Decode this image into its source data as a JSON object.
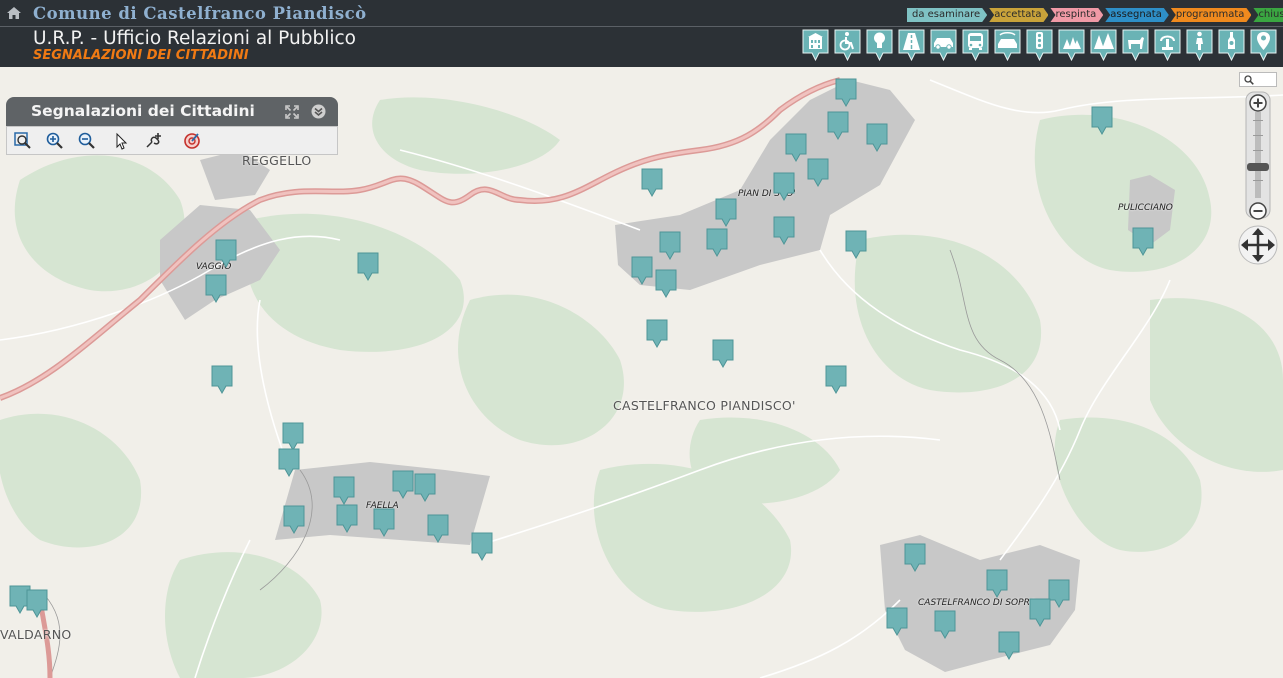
{
  "header": {
    "home_icon": "home-icon",
    "comune": "Comune di Castelfranco Piandiscò",
    "office": "U.R.P. - Ufficio Relazioni al Pubblico",
    "subtitle": "SEGNALAZIONI DEI CITTADINI"
  },
  "status_legend": [
    {
      "label": "da esaminare",
      "color": "#7fc2c4"
    },
    {
      "label": "accettata",
      "color": "#c9a33a"
    },
    {
      "label": "respinta",
      "color": "#f09aa6"
    },
    {
      "label": "assegnata",
      "color": "#2e8fc7"
    },
    {
      "label": "programmata",
      "color": "#f08a1e"
    },
    {
      "label": "chiusa",
      "color": "#3aa641"
    }
  ],
  "category_icons": [
    "public-building-icon",
    "accessibility-icon",
    "lighting-icon",
    "road-icon",
    "car-icon",
    "bus-icon",
    "car-wash-icon",
    "traffic-light-icon",
    "park-icon",
    "trees-icon",
    "animal-icon",
    "fountain-icon",
    "person-icon",
    "monument-icon",
    "location-pin-icon"
  ],
  "panel": {
    "title": "Segnalazioni dei Cittadini",
    "maximize_icon": "maximize-icon",
    "collapse_icon": "collapse-icon",
    "tools": [
      "zoom-extent-icon",
      "zoom-in-icon",
      "zoom-out-icon",
      "select-pointer-icon",
      "add-report-icon",
      "locate-icon"
    ]
  },
  "map": {
    "place_labels": [
      {
        "name": "REGGELLO"
      },
      {
        "name": "VAGGIO"
      },
      {
        "name": "PIAN DI SCO'"
      },
      {
        "name": "PULICCIANO"
      },
      {
        "name": "CASTELFRANCO PIANDISCO'"
      },
      {
        "name": "FAELLA"
      },
      {
        "name": "CASTELFRANCO DI SOPRA"
      },
      {
        "name": "VALDARNO"
      }
    ],
    "marker_count": 45,
    "marker_color": "#6fb3b5",
    "road_color": "#e8a3a0",
    "urban_color": "#c9c9c9",
    "forest_color": "#d3e3cf"
  },
  "zoom": {
    "search_icon": "search-icon",
    "zoom_in_icon": "zoom-in-icon",
    "zoom_out_icon": "zoom-out-icon",
    "pan_icon": "pan-arrows-icon"
  }
}
